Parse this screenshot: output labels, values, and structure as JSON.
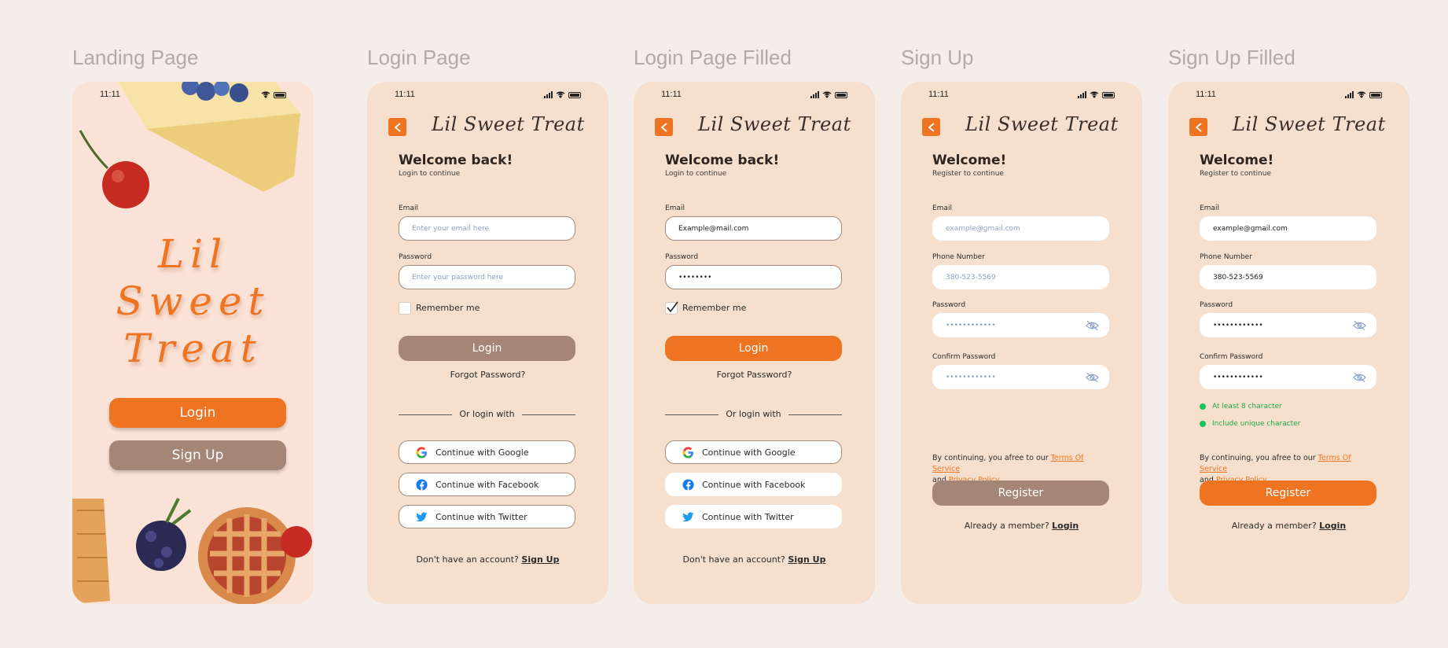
{
  "labels": {
    "landing": "Landing Page",
    "login": "Login Page",
    "login_filled": "Login Page Filled",
    "signup": "Sign Up",
    "signup_filled": "Sign Up Filled"
  },
  "status_time": "11:11",
  "brand": "Lil Sweet Treat",
  "landing": {
    "title_lines": [
      "Lil",
      "Sweet",
      "Treat"
    ],
    "login_label": "Login",
    "signup_label": "Sign Up"
  },
  "login": {
    "heading": "Welcome back!",
    "subheading": "Login to continue",
    "email_label": "Email",
    "email_placeholder": "Enter your email here",
    "password_label": "Password",
    "password_placeholder": "Enter your password here",
    "remember_label": "Remember me",
    "login_button": "Login",
    "forgot": "Forgot Password?",
    "divider": "Or login with",
    "google": "Continue with Google",
    "facebook": "Continue with Facebook",
    "twitter": "Continue with Twitter",
    "no_account": "Don't have an account?",
    "signup_link": "Sign Up"
  },
  "login_filled": {
    "email_value": "Example@mail.com",
    "password_value": "••••••••",
    "remember_checked": true
  },
  "signup": {
    "heading": "Welcome!",
    "subheading": "Register to continue",
    "email_label": "Email",
    "email_placeholder": "example@gmail.com",
    "phone_label": "Phone Number",
    "phone_placeholder": "380-523-5569",
    "password_label": "Password",
    "password_placeholder": "••••••••••••",
    "confirm_label": "Confirm Password",
    "confirm_placeholder": "••••••••••••",
    "terms_prefix": "By continuing, you afree to our",
    "terms_link": "Terms Of Service",
    "terms_and": "and",
    "privacy_link": "Privacy Policy",
    "register_button": "Register",
    "already": "Already a member?",
    "login_link": "Login"
  },
  "signup_filled": {
    "email_value": "example@gmail.com",
    "phone_value": "380-523-5569",
    "password_value": "••••••••••••",
    "confirm_value": "••••••••••••",
    "valid_1": "At least 8 character",
    "valid_2": "Include unique character"
  },
  "colors": {
    "accent": "#ef7422",
    "disabled_button": "#a48677",
    "phone_bg": "#f6e0cd",
    "valid": "#19c25a"
  },
  "icons": [
    "back-arrow-icon",
    "google-icon",
    "facebook-icon",
    "twitter-icon",
    "eye-off-icon",
    "checkmark-icon",
    "signal-icon",
    "wifi-icon",
    "battery-icon"
  ]
}
